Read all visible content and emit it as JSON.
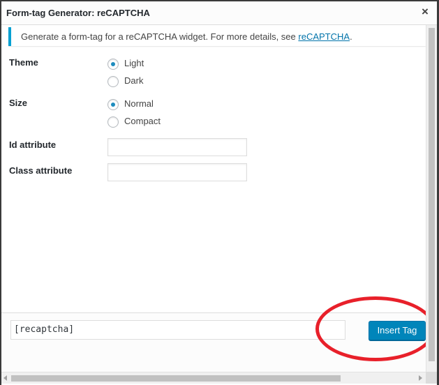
{
  "dialog": {
    "title": "Form-tag Generator: reCAPTCHA",
    "close_icon": "×"
  },
  "notice": {
    "text": "Generate a form-tag for a reCAPTCHA widget. For more details, see ",
    "link_text": "reCAPTCHA",
    "suffix": ".",
    "accent_color": "#00a0d2"
  },
  "fields": {
    "theme": {
      "label": "Theme",
      "options": [
        {
          "label": "Light",
          "checked": true
        },
        {
          "label": "Dark",
          "checked": false
        }
      ]
    },
    "size": {
      "label": "Size",
      "options": [
        {
          "label": "Normal",
          "checked": true
        },
        {
          "label": "Compact",
          "checked": false
        }
      ]
    },
    "id_attribute": {
      "label": "Id attribute",
      "value": ""
    },
    "class_attribute": {
      "label": "Class attribute",
      "value": ""
    }
  },
  "footer": {
    "tag_value": "[recaptcha]",
    "insert_button_label": "Insert Tag",
    "button_color": "#0085ba",
    "highlight_color": "#e8202a"
  }
}
